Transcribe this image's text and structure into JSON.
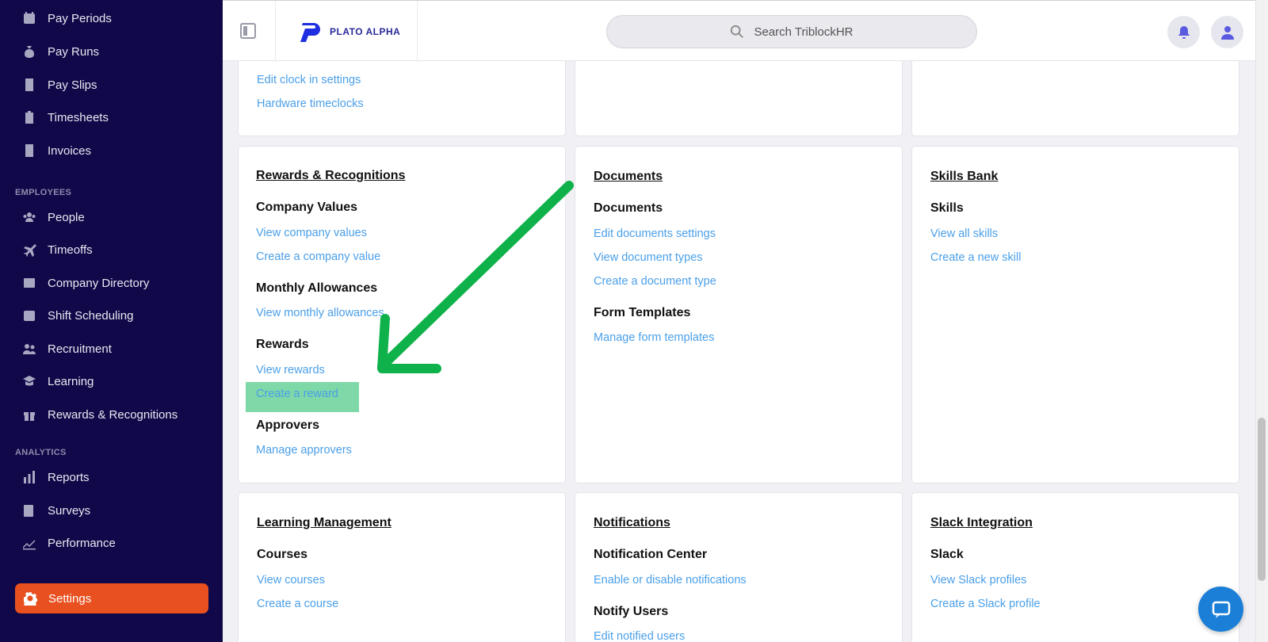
{
  "sidebar": {
    "items_top": [
      {
        "label": "Pay Periods",
        "icon": "calendar-icon"
      },
      {
        "label": "Pay Runs",
        "icon": "money-bag-icon"
      },
      {
        "label": "Pay Slips",
        "icon": "document-icon"
      },
      {
        "label": "Timesheets",
        "icon": "clipboard-icon"
      },
      {
        "label": "Invoices",
        "icon": "invoice-icon"
      }
    ],
    "section_employees": "EMPLOYEES",
    "items_employees": [
      {
        "label": "People",
        "icon": "people-icon"
      },
      {
        "label": "Timeoffs",
        "icon": "plane-icon"
      },
      {
        "label": "Company Directory",
        "icon": "contact-card-icon"
      },
      {
        "label": "Shift Scheduling",
        "icon": "calendar-icon"
      },
      {
        "label": "Recruitment",
        "icon": "users-icon"
      },
      {
        "label": "Learning",
        "icon": "graduation-cap-icon"
      },
      {
        "label": "Rewards & Recognitions",
        "icon": "gift-icon"
      }
    ],
    "section_analytics": "ANALYTICS",
    "items_analytics": [
      {
        "label": "Reports",
        "icon": "bar-chart-icon"
      },
      {
        "label": "Surveys",
        "icon": "survey-icon"
      },
      {
        "label": "Performance",
        "icon": "trend-icon"
      }
    ],
    "settings_label": "Settings"
  },
  "header": {
    "logo_text": "PLATO ALPHA",
    "search_placeholder": "Search TriblockHR"
  },
  "top_cards": {
    "left_links": [
      "Edit clock in settings",
      "Hardware timeclocks"
    ]
  },
  "cards": {
    "rewards": {
      "title": "Rewards & Recognitions",
      "company_values": "Company Values",
      "view_company_values": "View company values",
      "create_company_value": "Create a company value",
      "monthly_allowances": "Monthly Allowances",
      "view_monthly_allowances": "View monthly allowances",
      "rewards": "Rewards",
      "view_rewards": "View rewards",
      "create_reward": "Create a reward",
      "approvers": "Approvers",
      "manage_approvers": "Manage approvers"
    },
    "documents": {
      "title": "Documents",
      "documents": "Documents",
      "edit_documents_settings": "Edit documents settings",
      "view_document_types": "View document types",
      "create_document_type": "Create a document type",
      "form_templates": "Form Templates",
      "manage_form_templates": "Manage form templates"
    },
    "skills": {
      "title": "Skills Bank",
      "skills": "Skills",
      "view_all_skills": "View all skills",
      "create_new_skill": "Create a new skill"
    },
    "learning": {
      "title": "Learning Management",
      "courses": "Courses",
      "view_courses": "View courses",
      "create_course": "Create a course"
    },
    "notifications": {
      "title": "Notifications",
      "notification_center": "Notification Center",
      "enable_disable": "Enable or disable notifications",
      "notify_users": "Notify Users",
      "edit_notified_users": "Edit notified users"
    },
    "slack": {
      "title": "Slack Integration",
      "slack": "Slack",
      "view_slack_profiles": "View Slack profiles",
      "create_slack_profile": "Create a Slack profile"
    }
  },
  "colors": {
    "sidebar_bg": "#100848",
    "accent_orange": "#e8501f",
    "link_blue": "#4a9fe8",
    "highlight_green": "#7fd8a8",
    "arrow_green": "#0fb24a"
  }
}
